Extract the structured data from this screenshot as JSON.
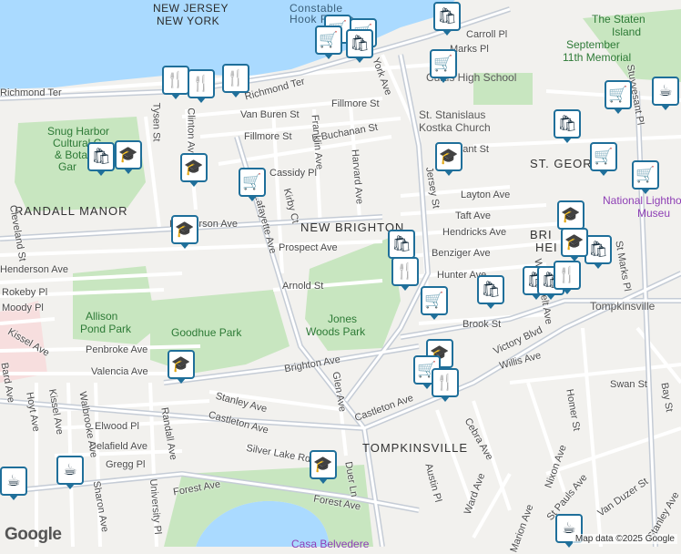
{
  "colors": {
    "land": "#f2f1ee",
    "water": "#aadaff",
    "park": "#c8e6c0",
    "pin_border": "#1f6f9a",
    "street": "#ffffff",
    "arterial": "#c5ccd6"
  },
  "water_labels": [
    "NEW JERSEY",
    "NEW YORK",
    "Constable",
    "Hook Reach"
  ],
  "neighborhoods": [
    "RANDALL MANOR",
    "NEW BRIGHTON",
    "ST. GEORGE",
    "TOMPKINSVILLE",
    "BRI",
    "HEI"
  ],
  "parks": {
    "snug_harbor": [
      "Snug Harbor",
      "Cultural C",
      "& Bota",
      "Gar"
    ],
    "allison": [
      "Allison",
      "Pond Park"
    ],
    "goodhue": "Goodhue Park",
    "jones_woods": [
      "Jones",
      "Woods Park"
    ]
  },
  "pois": {
    "staten_island_memorial": [
      "The Staten",
      "Island",
      "September",
      "11th Memorial"
    ],
    "curtis_school": "Curtis High School",
    "church": [
      "St. Stanislaus",
      "Kostka Church"
    ],
    "lighthouse": [
      "National Lighthouse",
      "Museu"
    ],
    "tompkinsville_station": "Tompkinsville",
    "casa_belvedere": "Casa Belvedere"
  },
  "streets": [
    "Richmond Ter",
    "Richmond Ter",
    "Carroll Pl",
    "Marks Pl",
    "York Ave",
    "Van Buren St",
    "Fillmore St",
    "Fillmore St",
    "E Buchanan St",
    "Tysen St",
    "Clinton Ave",
    "Franklin Ave",
    "Harvard Ave",
    "Cassidy Pl",
    "Layton Ave",
    "Taft Ave",
    "Hendricks Ave",
    "Henderson Ave",
    "Prospect Ave",
    "Kirby Ct",
    "Lafayette Ave",
    "Arnold St",
    "Jersey St",
    "Benziger Ave",
    "Hunter Ave",
    "Westervelt Ave",
    "Brook St",
    "Victory Blvd",
    "Willis Ave",
    "Henderson Ave",
    "Rokeby Pl",
    "Moody Pl",
    "Kissel Ave",
    "Penbroke Ave",
    "Valencia Ave",
    "Brighton Ave",
    "Glen Ave",
    "Stanley Ave",
    "Castleton Ave",
    "Castleton Ave",
    "Elwood Pl",
    "Delafield Ave",
    "Gregg Pl",
    "Hoyt Ave",
    "Kissel Ave",
    "Walbrooke Ave",
    "Randall Ave",
    "Silver Lake Rd",
    "Forest Ave",
    "Forest Ave",
    "Duer Ln",
    "Cebra Ave",
    "Ward Ave",
    "Austin Pl",
    "Nixon Ave",
    "St Pauls Ave",
    "Van Duzer St",
    "Homer St",
    "Swan St",
    "Bay St",
    "Marion Ave",
    "Sharon Ave",
    "University Pl",
    "Stanley Ave",
    "Bard Ave",
    "St Marks Pl",
    "Stuyvesant Pl",
    "Grant St",
    "Cleveland St"
  ],
  "pins": [
    {
      "type": "shopping",
      "glyph": "🛍"
    },
    {
      "type": "grocery",
      "glyph": "🛒"
    },
    {
      "type": "grocery",
      "glyph": "🛒"
    },
    {
      "type": "grocery",
      "glyph": "🛒"
    },
    {
      "type": "shopping",
      "glyph": "🛍"
    },
    {
      "type": "restaurant",
      "glyph": "🍴"
    },
    {
      "type": "restaurant",
      "glyph": "🍴"
    },
    {
      "type": "restaurant",
      "glyph": "🍴"
    },
    {
      "type": "school",
      "glyph": "🎓"
    },
    {
      "type": "shopping",
      "glyph": "🛍"
    },
    {
      "type": "grocery",
      "glyph": "🛒"
    },
    {
      "type": "cafe",
      "glyph": "☕"
    },
    {
      "type": "shopping",
      "glyph": "🛍"
    },
    {
      "type": "grocery",
      "glyph": "🛒"
    },
    {
      "type": "grocery",
      "glyph": "🛒"
    },
    {
      "type": "grocery",
      "glyph": "🛒"
    },
    {
      "type": "school",
      "glyph": "🎓"
    },
    {
      "type": "shopping",
      "glyph": "🛍"
    },
    {
      "type": "school",
      "glyph": "🎓"
    },
    {
      "type": "school",
      "glyph": "🎓"
    },
    {
      "type": "shopping",
      "glyph": "🛍"
    },
    {
      "type": "school",
      "glyph": "🎓"
    },
    {
      "type": "grocery",
      "glyph": "🛒"
    },
    {
      "type": "shopping",
      "glyph": "🛍"
    },
    {
      "type": "restaurant",
      "glyph": "🍴"
    },
    {
      "type": "school",
      "glyph": "🎓"
    },
    {
      "type": "shopping",
      "glyph": "🛍"
    },
    {
      "type": "shopping",
      "glyph": "🛍"
    },
    {
      "type": "restaurant",
      "glyph": "🍴"
    },
    {
      "type": "grocery",
      "glyph": "🛒"
    },
    {
      "type": "school",
      "glyph": "🎓"
    },
    {
      "type": "grocery",
      "glyph": "🛒"
    },
    {
      "type": "restaurant",
      "glyph": "🍴"
    },
    {
      "type": "school",
      "glyph": "🎓"
    },
    {
      "type": "cafe",
      "glyph": "☕"
    },
    {
      "type": "cafe",
      "glyph": "☕"
    },
    {
      "type": "cafe",
      "glyph": "☕"
    }
  ],
  "branding": {
    "logo": "Google",
    "attribution": "Map data ©2025 Google"
  }
}
